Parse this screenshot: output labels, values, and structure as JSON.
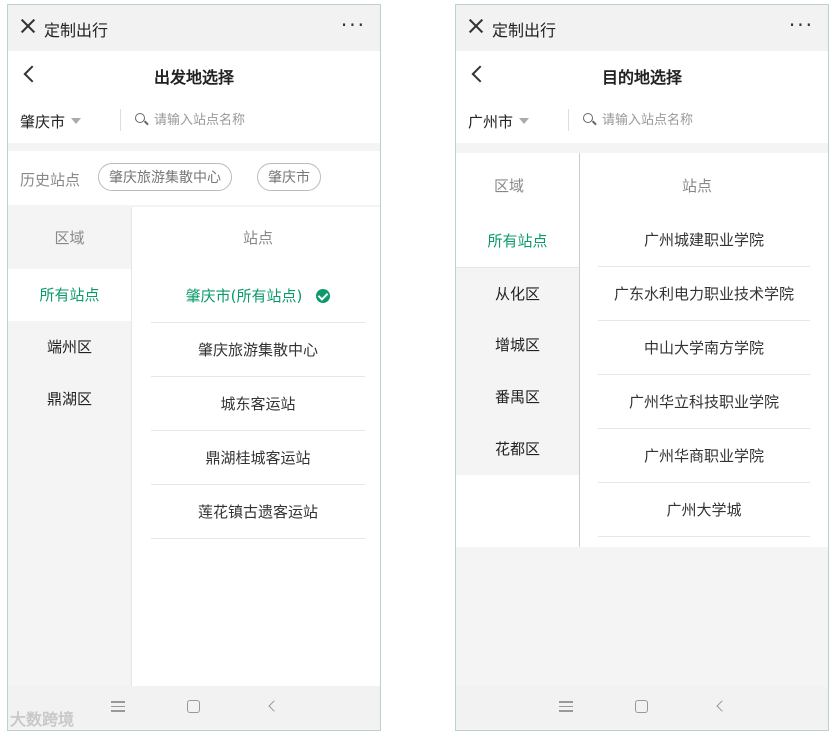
{
  "left": {
    "app_title": "定制出行",
    "more_label": "···",
    "page_title": "出发地选择",
    "city": "肇庆市",
    "search_placeholder": "请输入站点名称",
    "history_label": "历史站点",
    "history_chips": [
      "肇庆旅游集散中心",
      "肇庆市"
    ],
    "region_header": "区域",
    "station_header": "站点",
    "regions": [
      "所有站点",
      "端州区",
      "鼎湖区"
    ],
    "active_region": "所有站点",
    "stations": [
      "肇庆市(所有站点)",
      "肇庆旅游集散中心",
      "城东客运站",
      "鼎湖桂城客运站",
      "莲花镇古遗客运站"
    ],
    "selected_station": "肇庆市(所有站点)"
  },
  "right": {
    "app_title": "定制出行",
    "more_label": "···",
    "page_title": "目的地选择",
    "city": "广州市",
    "search_placeholder": "请输入站点名称",
    "region_header": "区域",
    "station_header": "站点",
    "regions": [
      "所有站点",
      "从化区",
      "增城区",
      "番禺区",
      "花都区"
    ],
    "active_region": "所有站点",
    "stations": [
      "广州城建职业学院",
      "广东水利电力职业技术学院",
      "中山大学南方学院",
      "广州华立科技职业学院",
      "广州华商职业学院",
      "广州大学城"
    ]
  },
  "watermark": "大数跨境",
  "colors": {
    "accent": "#0b9a6c",
    "background": "#f4f4f4"
  },
  "icons": [
    "close-icon",
    "more-icon",
    "back-chevron-icon",
    "search-icon",
    "dropdown-caret-icon",
    "checkmark-icon",
    "nav-menu-icon",
    "nav-home-icon",
    "nav-back-icon"
  ]
}
